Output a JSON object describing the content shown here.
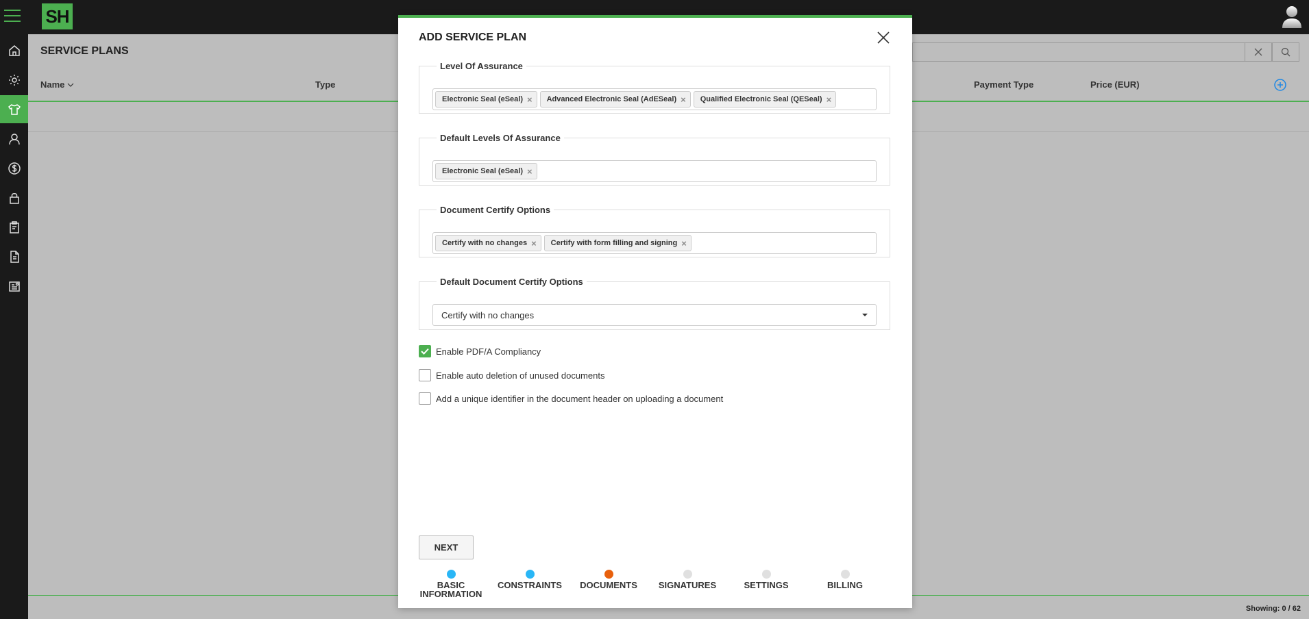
{
  "app": {
    "logo_text": "SH"
  },
  "page": {
    "title": "SERVICE PLANS",
    "columns": [
      "Name",
      "Type",
      "Payment Type",
      "Price (EUR)"
    ],
    "showing": "Showing: 0 / 62"
  },
  "modal": {
    "title": "ADD SERVICE PLAN",
    "level_of_assurance": {
      "legend": "Level Of Assurance",
      "tags": [
        "Electronic Seal (eSeal)",
        "Advanced Electronic Seal (AdESeal)",
        "Qualified Electronic Seal (QESeal)"
      ]
    },
    "default_levels": {
      "legend": "Default Levels Of Assurance",
      "tags": [
        "Electronic Seal (eSeal)"
      ]
    },
    "certify_options": {
      "legend": "Document Certify Options",
      "tags": [
        "Certify with no changes",
        "Certify with form filling and signing"
      ]
    },
    "default_certify": {
      "legend": "Default Document Certify Options",
      "selected": "Certify with no changes"
    },
    "checkboxes": [
      {
        "label": "Enable PDF/A Compliancy",
        "checked": true
      },
      {
        "label": "Enable auto deletion of unused documents",
        "checked": false
      },
      {
        "label": "Add a unique identifier in the document header on uploading a document",
        "checked": false
      }
    ],
    "next_label": "NEXT",
    "steps": [
      {
        "label": "BASIC\nINFORMATION",
        "state": "done",
        "color": "#29b6f6"
      },
      {
        "label": "CONSTRAINTS",
        "state": "done",
        "color": "#29b6f6"
      },
      {
        "label": "DOCUMENTS",
        "state": "current",
        "color": "#e8600c"
      },
      {
        "label": "SIGNATURES",
        "state": "pending",
        "color": "#e0e0e0"
      },
      {
        "label": "SETTINGS",
        "state": "pending",
        "color": "#e0e0e0"
      },
      {
        "label": "BILLING",
        "state": "pending",
        "color": "#e0e0e0"
      }
    ]
  },
  "colors": {
    "accent": "#4caf50",
    "add_icon": "#1e88e5"
  }
}
